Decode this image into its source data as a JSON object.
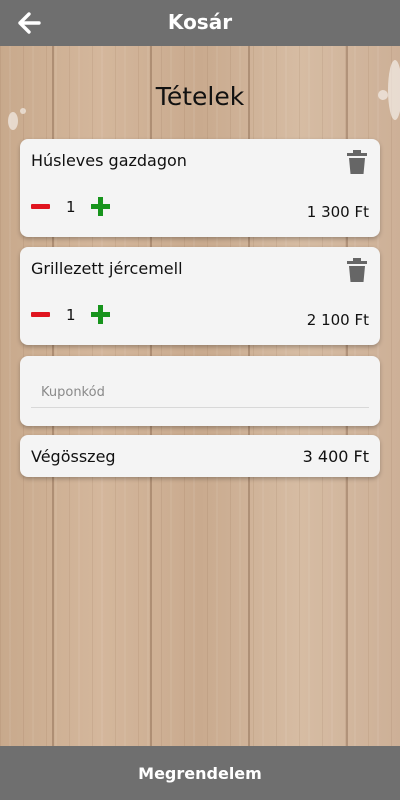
{
  "header": {
    "title": "Kosár",
    "back_icon": "arrow-left-icon"
  },
  "section_title": "Tételek",
  "items": [
    {
      "name": "Húsleves gazdagon",
      "quantity": "1",
      "price": "1 300 Ft"
    },
    {
      "name": "Grillezett jércemell",
      "quantity": "1",
      "price": "2 100 Ft"
    }
  ],
  "coupon": {
    "placeholder": "Kuponkód",
    "value": ""
  },
  "total": {
    "label": "Végösszeg",
    "value": "3 400 Ft"
  },
  "order_button": {
    "label": "Megrendelem"
  },
  "colors": {
    "header_bg": "#6f6f6f",
    "minus": "#e0141e",
    "plus": "#17941c",
    "card_bg": "#f4f4f4"
  }
}
